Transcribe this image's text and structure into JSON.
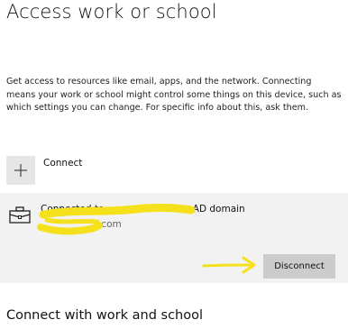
{
  "page": {
    "title": "Access work or school",
    "description": "Get access to resources like email, apps, and the network. Connecting means your work or school might control some things on this device, such as which settings you can change. For specific info about this, ask them."
  },
  "connect": {
    "icon": "plus-icon",
    "label": "Connect"
  },
  "account": {
    "icon": "briefcase-icon",
    "title_prefix": "Connected to ",
    "title_suffix": "AD domain",
    "domain_suffix": ".com",
    "disconnect_label": "Disconnect"
  },
  "annotations": {
    "highlight_color": "#f5e11b"
  },
  "section": {
    "heading": "Connect with work and school"
  },
  "colors": {
    "card_background": "#f2f2f2",
    "button_background": "#cccccc",
    "tile_background": "#e6e6e6"
  }
}
